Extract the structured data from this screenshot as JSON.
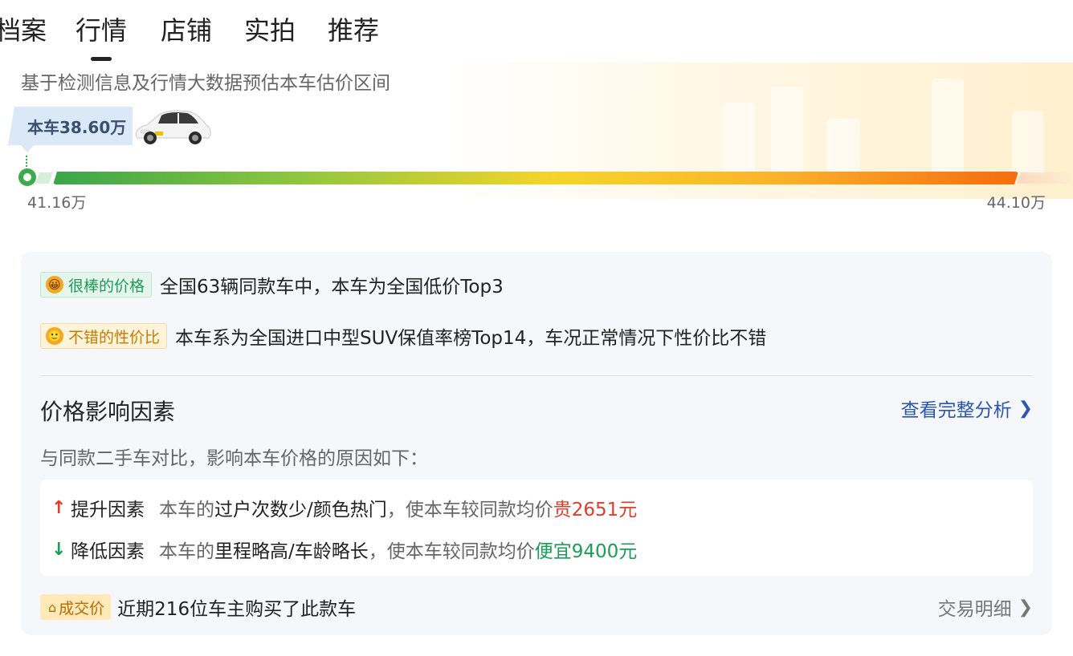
{
  "tabs": [
    {
      "label": "档案"
    },
    {
      "label": "行情"
    },
    {
      "label": "店铺"
    },
    {
      "label": "实拍"
    },
    {
      "label": "推荐"
    }
  ],
  "active_tab": "行情",
  "estimate": {
    "description": "基于检测信息及行情大数据预估本车估价区间",
    "car_price": "本车38.60万",
    "range_low": "41.16万",
    "range_high": "44.10万"
  },
  "highlights": [
    {
      "badge": "很棒的价格",
      "icon": "grin-emoji-icon",
      "text": "全国63辆同款车中，本车为全国低价Top3"
    },
    {
      "badge": "不错的性价比",
      "icon": "smile-emoji-icon",
      "text": "本车系为全国进口中型SUV保值率榜Top14，车况正常情况下性价比不错"
    }
  ],
  "factors_section": {
    "title": "价格影响因素",
    "link": "查看完整分析",
    "subtitle": "与同款二手车对比，影响本车价格的原因如下：",
    "raise": {
      "label": "提升因素",
      "prefix": "本车的",
      "reason": "过户次数少/颜色热门",
      "middle": "，使本车较同款均价",
      "amount": "贵2651元"
    },
    "lower": {
      "label": "降低因素",
      "prefix": "本车的",
      "reason": "里程略高/车龄略长",
      "middle": "，使本车较同款均价",
      "amount": "便宜9400元"
    }
  },
  "deal": {
    "badge": "成交价",
    "text": "近期216位车主购买了此款车",
    "link": "交易明细"
  },
  "colors": {
    "accent_blue": "#2a56b0",
    "raise_red": "#e03c2c",
    "lower_green": "#1a9e56",
    "range_start": "#3aa54a",
    "range_end": "#f56c0e"
  }
}
